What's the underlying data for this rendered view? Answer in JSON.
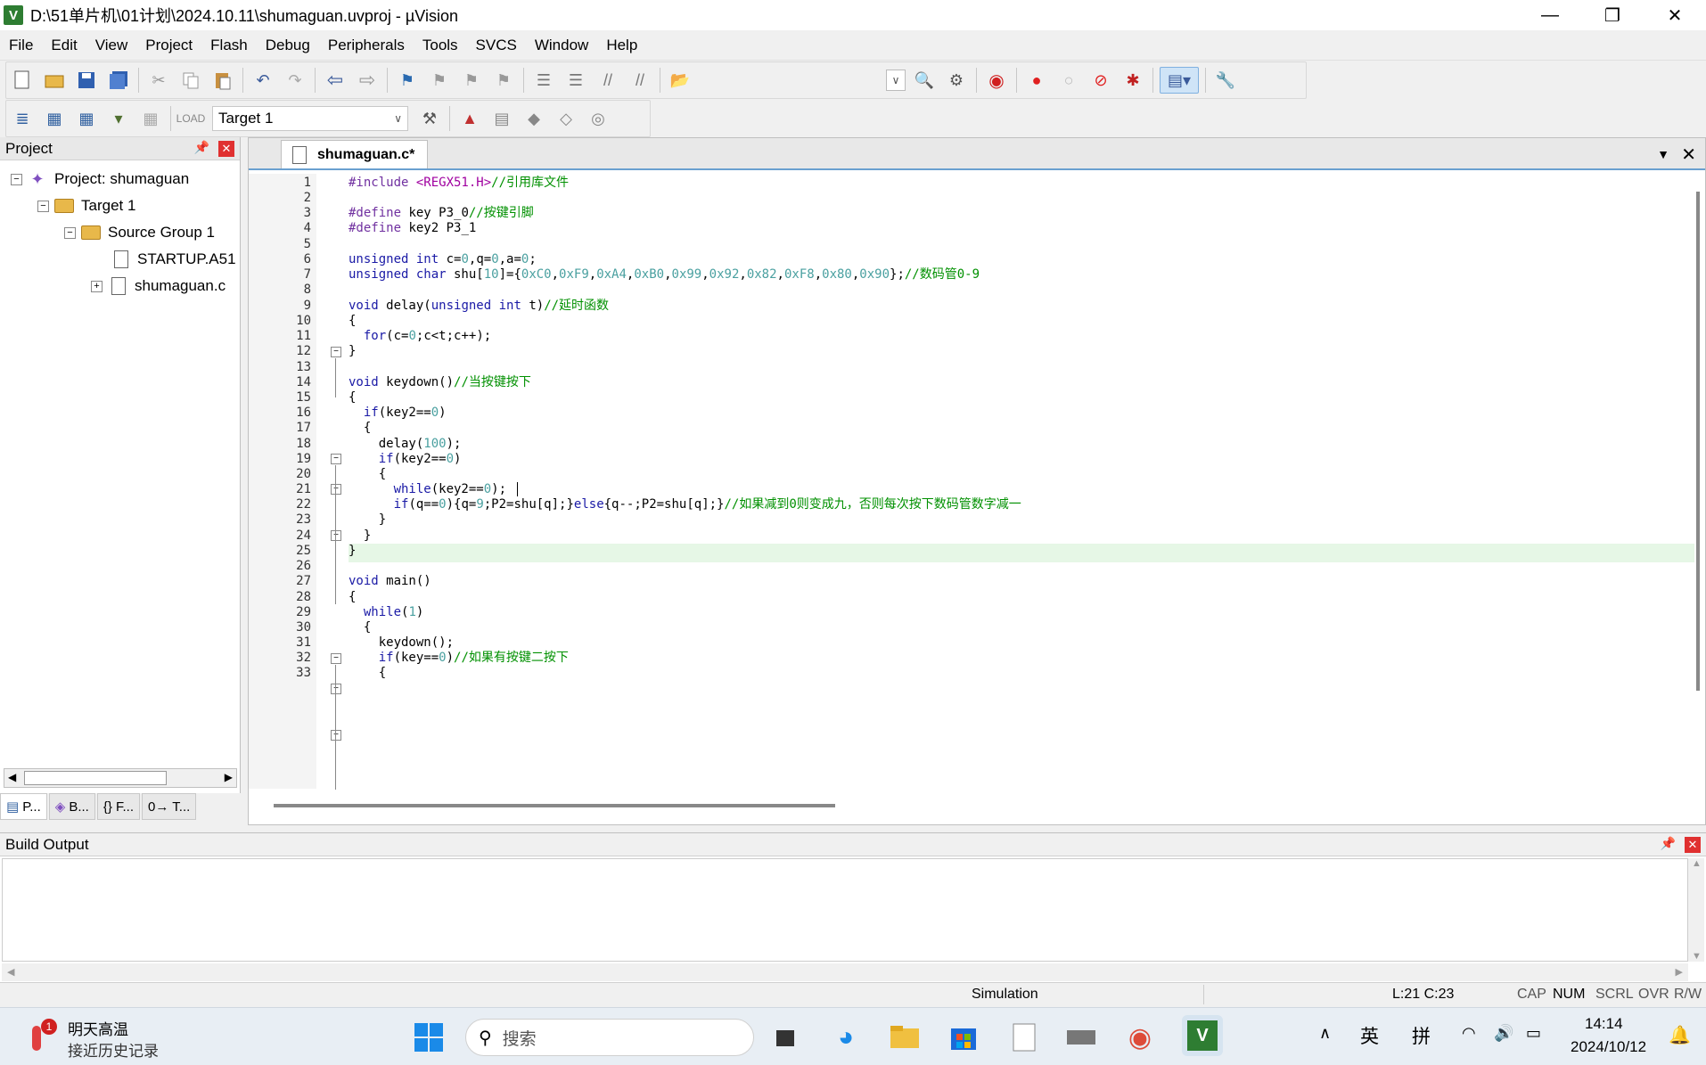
{
  "window": {
    "title": "D:\\51单片机\\01计划\\2024.10.11\\shumaguan.uvproj - µVision",
    "app_icon": "V",
    "minimize": "—",
    "restore": "❐",
    "close": "✕"
  },
  "menu": [
    "File",
    "Edit",
    "View",
    "Project",
    "Flash",
    "Debug",
    "Peripherals",
    "Tools",
    "SVCS",
    "Window",
    "Help"
  ],
  "toolbar": {
    "target": "Target 1"
  },
  "project_panel": {
    "title": "Project",
    "tree": {
      "project": "Project: shumaguan",
      "target": "Target 1",
      "group": "Source Group 1",
      "file1": "STARTUP.A51",
      "file2": "shumaguan.c"
    },
    "tabs": [
      "P...",
      "B...",
      "{} F...",
      "0→ T..."
    ]
  },
  "editor": {
    "tab_label": "shumaguan.c*",
    "cursor_line": 21,
    "lines": [
      "1",
      "2",
      "3",
      "4",
      "5",
      "6",
      "7",
      "8",
      "9",
      "10",
      "11",
      "12",
      "13",
      "14",
      "15",
      "16",
      "17",
      "18",
      "19",
      "20",
      "21",
      "22",
      "23",
      "24",
      "25",
      "26",
      "27",
      "28",
      "29",
      "30",
      "31",
      "32",
      "33"
    ],
    "code": {
      "l1a": "#include ",
      "l1b": "<REGX51.H>",
      "l1c": "//引用库文件",
      "l3a": "#define",
      "l3b": " key P3_0",
      "l3c": "//按键引脚",
      "l4a": "#define",
      "l4b": " key2 P3_1",
      "l6a": "unsigned int",
      "l6b": " c=",
      "l6c": "0",
      "l6d": ",q=",
      "l6e": "0",
      "l6f": ",a=",
      "l6g": "0",
      "l6h": ";",
      "l7a": "unsigned char",
      "l7b": " shu[",
      "l7c": "10",
      "l7d": "]={",
      "l7e": "0xC0",
      "l7f": ",",
      "l7g": "0xF9",
      "l7h": "0xA4",
      "l7i": "0xB0",
      "l7j": "0x99",
      "l7k": "0x92",
      "l7l": "0x82",
      "l7m": "0xF8",
      "l7n": "0x80",
      "l7o": "0x90",
      "l7p": "};",
      "l7q": "//数码管0-9",
      "l9a": "void",
      "l9b": " delay(",
      "l9c": "unsigned int",
      "l9d": " t)",
      "l9e": "//延时函数",
      "l10": "{",
      "l11a": "  for",
      "l11b": "(c=",
      "l11c": "0",
      "l11d": ";c<t;c++);",
      "l12": "}",
      "l14a": "void",
      "l14b": " keydown()",
      "l14c": "//当按键按下",
      "l15": "{",
      "l16a": "  if",
      "l16b": "(key2==",
      "l16c": "0",
      "l16d": ")",
      "l17": "  {",
      "l18a": "    delay(",
      "l18b": "100",
      "l18c": ");",
      "l19a": "    if",
      "l19b": "(key2==",
      "l19c": "0",
      "l19d": ")",
      "l20": "    {",
      "l21a": "      while",
      "l21b": "(key2==",
      "l21c": "0",
      "l21d": ");",
      "l22a": "      if",
      "l22b": "(q==",
      "l22c": "0",
      "l22d": "){q=",
      "l22e": "9",
      "l22f": ";P2=shu[q];}",
      "l22g": "else",
      "l22h": "{q--;P2=shu[q];}",
      "l22i": "//如果减到0则变成九，否则每次按下数码管数字减一",
      "l23": "    }",
      "l24": "  }",
      "l25": "}",
      "l27a": "void",
      "l27b": " main()",
      "l28": "{",
      "l29a": "  while",
      "l29b": "(",
      "l29c": "1",
      "l29d": ")",
      "l30": "  {",
      "l31": "    keydown();",
      "l32a": "    if",
      "l32b": "(key==",
      "l32c": "0",
      "l32d": ")",
      "l32e": "//如果有按键二按下",
      "l33": "    {"
    }
  },
  "build_output": {
    "title": "Build Output"
  },
  "statusbar": {
    "mode": "Simulation",
    "position": "L:21 C:23",
    "cap": "CAP",
    "num": "NUM",
    "scrl": "SCRL",
    "ovr": "OVR",
    "rw": "R/W"
  },
  "taskbar": {
    "weather_title": "明天高温",
    "weather_sub": "接近历史记录",
    "weather_badge": "1",
    "search_placeholder": "搜索",
    "ime1": "英",
    "ime2": "拼",
    "time": "14:14",
    "date": "2024/10/12"
  }
}
